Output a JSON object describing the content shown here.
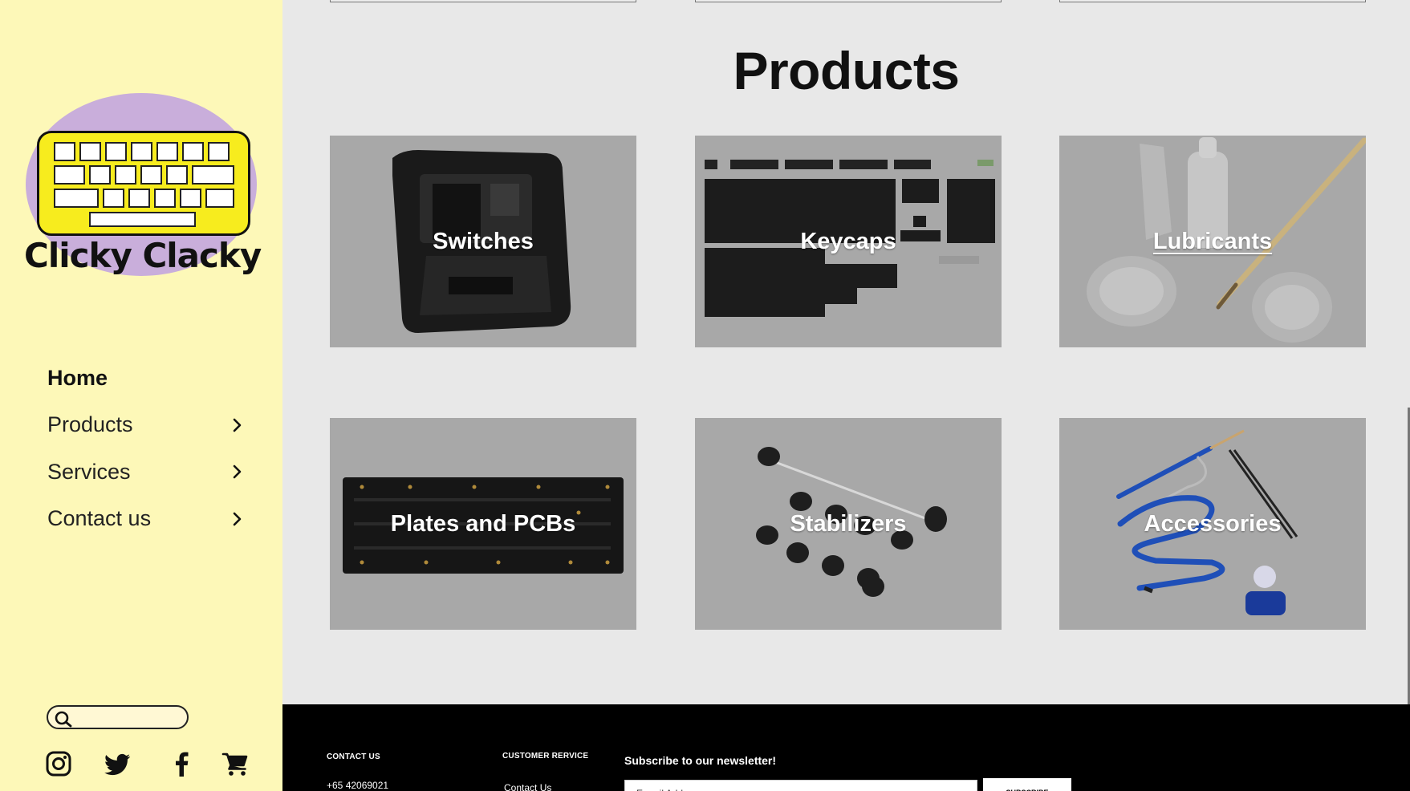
{
  "brand": {
    "name": "Clicky Clacky"
  },
  "nav": {
    "items": [
      {
        "label": "Home",
        "active": true,
        "has_submenu": false
      },
      {
        "label": "Products",
        "active": false,
        "has_submenu": true
      },
      {
        "label": "Services",
        "active": false,
        "has_submenu": true
      },
      {
        "label": "Contact us",
        "active": false,
        "has_submenu": true
      }
    ]
  },
  "search": {
    "placeholder": "",
    "value": ""
  },
  "social": [
    "instagram-icon",
    "twitter-icon",
    "facebook-icon",
    "shopping-cart-icon"
  ],
  "main": {
    "title": "Products",
    "cards": [
      {
        "label": "Switches",
        "art": "switch"
      },
      {
        "label": "Keycaps",
        "art": "keycaps"
      },
      {
        "label": "Lubricants",
        "art": "lubricants",
        "hovered": true
      },
      {
        "label": "Plates and PCBs",
        "art": "pcb"
      },
      {
        "label": "Stabilizers",
        "art": "stabilizers"
      },
      {
        "label": "Accessories",
        "art": "accessories"
      }
    ]
  },
  "footer": {
    "contact_heading": "CONTACT US",
    "phone": "+65 42069021",
    "service_heading": "CUSTOMER RERVICE",
    "service_link": "Contact Us",
    "newsletter_heading": "Subscribe to our newsletter!",
    "email_placeholder": "E-mail Address",
    "subscribe_label": "SUBSCRIBE"
  },
  "colors": {
    "sidebar_bg": "#fdf8b8",
    "logo_oval": "#c9aedb",
    "logo_keyboard": "#f7ec1e",
    "main_bg": "#e8e8e8",
    "card_bg": "#a8a8a8",
    "footer_bg": "#000000"
  }
}
